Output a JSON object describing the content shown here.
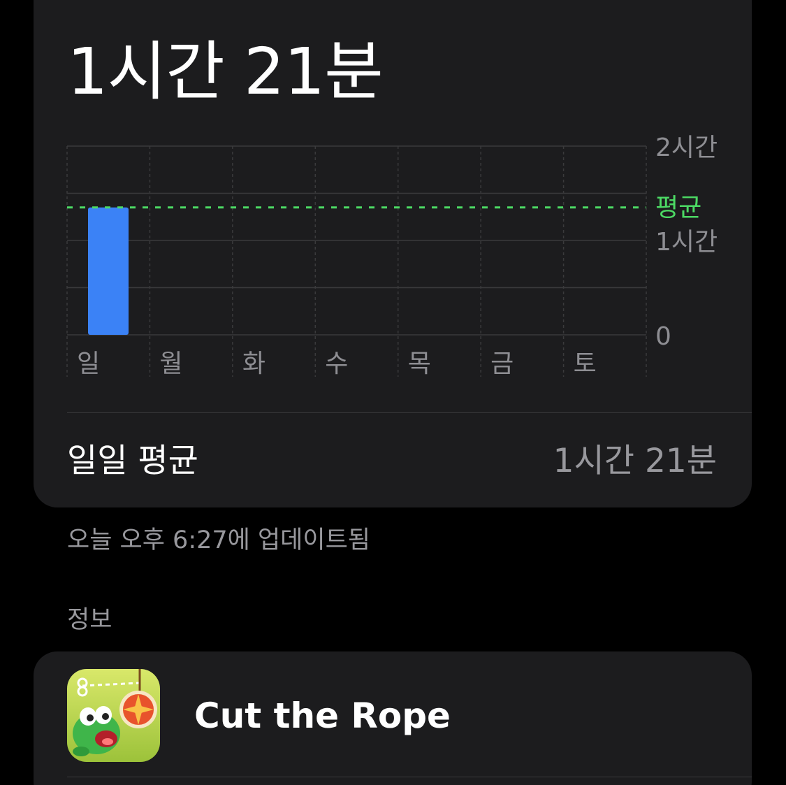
{
  "summary": {
    "total_time": "1시간 21분"
  },
  "chart_data": {
    "type": "bar",
    "categories": [
      "일",
      "월",
      "화",
      "수",
      "목",
      "금",
      "토"
    ],
    "values": [
      81,
      0,
      0,
      0,
      0,
      0,
      0
    ],
    "unit": "minutes",
    "ylim": [
      0,
      120
    ],
    "y_ticks": [
      {
        "value": 120,
        "label": "2시간"
      },
      {
        "value": 60,
        "label": "1시간"
      },
      {
        "value": 0,
        "label": "0"
      }
    ],
    "average": {
      "value": 81,
      "label": "평균"
    },
    "grid": true,
    "bar_color": "#3b82f6",
    "average_color": "#4cd964"
  },
  "daily_average": {
    "label": "일일 평균",
    "value": "1시간 21분"
  },
  "updated_text": "오늘 오후 6:27에 업데이트됨",
  "info_section": {
    "header": "정보",
    "app": {
      "name": "Cut the Rope",
      "icon": "cut-the-rope-app-icon"
    }
  },
  "colors": {
    "background": "#000000",
    "card": "#1c1c1e",
    "secondary_text": "#98989d"
  }
}
